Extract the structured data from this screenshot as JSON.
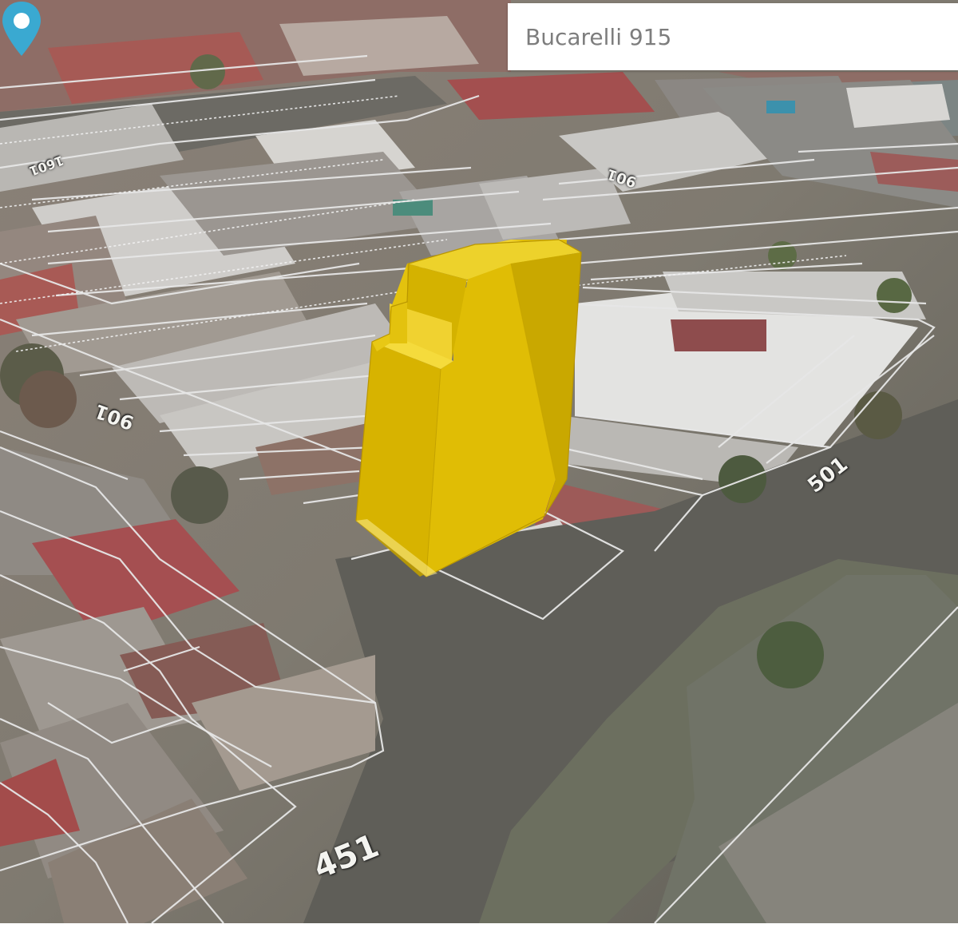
{
  "search": {
    "value": "Bucarelli 915",
    "placeholder": "Bucarelli 915"
  },
  "map": {
    "street_numbers": [
      "451",
      "501",
      "901",
      "901",
      "1601"
    ],
    "building_color": "#e8c200",
    "marker_color": "#3aa9d1",
    "parcel_line_color": "#e6e6e6"
  },
  "icons": {
    "marker": "map-pin-icon"
  }
}
